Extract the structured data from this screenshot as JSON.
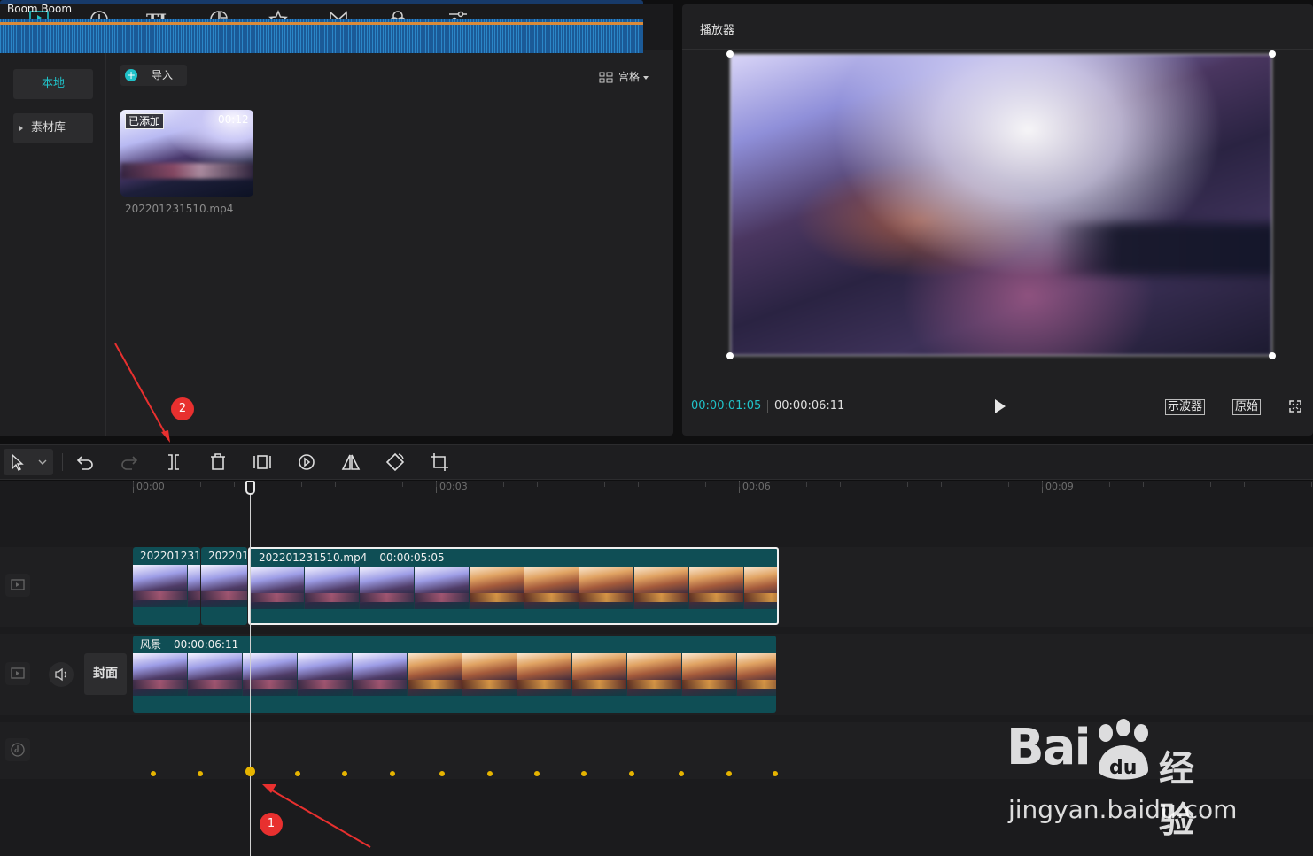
{
  "tabs": [
    {
      "label": "媒体",
      "icon": "media-icon",
      "active": true
    },
    {
      "label": "音频",
      "icon": "audio-icon"
    },
    {
      "label": "文本",
      "icon": "text-icon"
    },
    {
      "label": "贴纸",
      "icon": "sticker-icon"
    },
    {
      "label": "特效",
      "icon": "effects-icon"
    },
    {
      "label": "转场",
      "icon": "transition-icon"
    },
    {
      "label": "滤镜",
      "icon": "filter-icon"
    },
    {
      "label": "调节",
      "icon": "adjust-icon"
    }
  ],
  "sidebar": {
    "local": "本地",
    "library": "素材库"
  },
  "media": {
    "import_label": "导入",
    "view_label": "宫格",
    "item": {
      "badge": "已添加",
      "duration": "00:12",
      "filename": "202201231510.mp4"
    }
  },
  "player": {
    "title": "播放器",
    "current_time": "00:00:01:05",
    "total_time": "00:00:06:11",
    "scope_label": "示波器",
    "original_label": "原始"
  },
  "timeline": {
    "ruler": [
      "00:00",
      "00:03",
      "00:06",
      "00:09"
    ],
    "video_track": {
      "clip_a": "202201231",
      "clip_b": "2022012",
      "clip_c_name": "202201231510.mp4",
      "clip_c_duration": "00:00:05:05"
    },
    "main_track": {
      "name": "风景",
      "duration": "00:00:06:11",
      "cover_label": "封面"
    },
    "audio_track": {
      "name": "Boom Boom"
    }
  },
  "annotations": {
    "marker_1": "1",
    "marker_2": "2"
  },
  "watermark": {
    "brand": "Bai",
    "brand_cn": "经验",
    "url": "jingyan.baidu.com"
  },
  "colors": {
    "accent": "#20c2c9",
    "clip_teal": "#0f4e55",
    "audio_blue": "#173a6a",
    "beat_yellow": "#e6b400",
    "annotation_red": "#e8302f"
  }
}
